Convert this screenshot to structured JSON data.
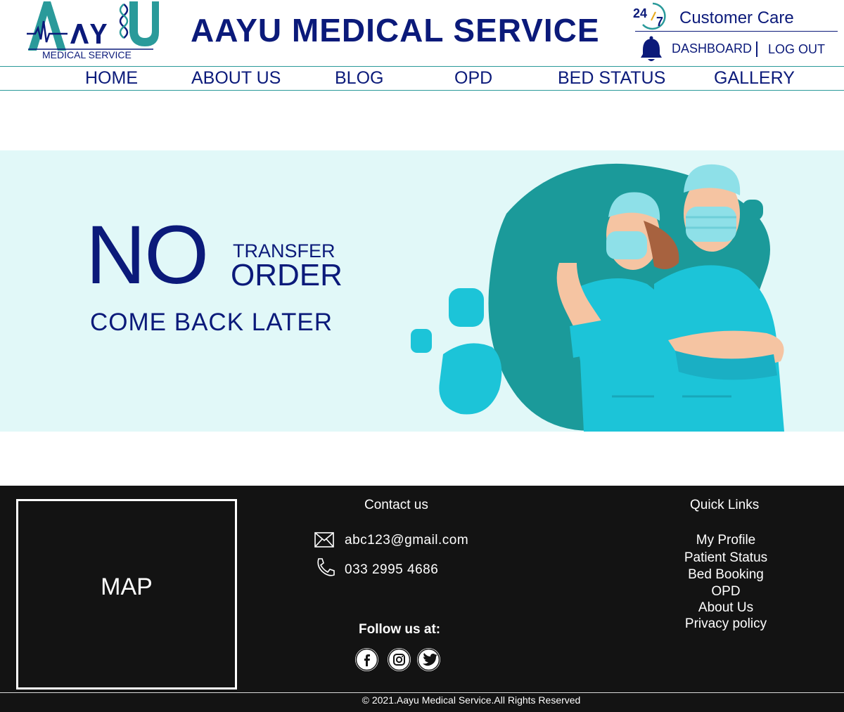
{
  "header": {
    "logo_text": "AAYU",
    "logo_subtitle": "MEDICAL SERVICE",
    "site_title": "AAYU MEDICAL SERVICE",
    "customer_care_badge": "24/7",
    "customer_care_label": "Customer Care",
    "dashboard_label": "DASHBOARD",
    "logout_label": "LOG OUT"
  },
  "nav": {
    "items": [
      {
        "label": "HOME"
      },
      {
        "label": "ABOUT US"
      },
      {
        "label": "BLOG"
      },
      {
        "label": "OPD"
      },
      {
        "label": "BED STATUS"
      },
      {
        "label": "GALLERY"
      }
    ]
  },
  "banner": {
    "no_text": "NO",
    "transfer_text": "TRANSFER",
    "order_text": "ORDER",
    "come_back_text": "COME BACK LATER"
  },
  "footer": {
    "map_label": "MAP",
    "contact_title": "Contact us",
    "email": "abc123@gmail.com",
    "phone": "033 2995 4686",
    "follow_title": "Follow us at:",
    "social": [
      "facebook-icon",
      "instagram-icon",
      "twitter-icon"
    ],
    "quick_links_title": "Quick Links",
    "quick_links": [
      "My Profile",
      "Patient Status",
      "Bed Booking",
      "OPD",
      "About Us",
      "Privacy policy"
    ],
    "copyright": "© 2021.Aayu Medical Service.All Rights Reserved"
  },
  "colors": {
    "brand_navy": "#0b1a7a",
    "brand_teal": "#2a9a9a",
    "banner_bg": "#e1f8f8",
    "footer_bg": "#131313"
  }
}
